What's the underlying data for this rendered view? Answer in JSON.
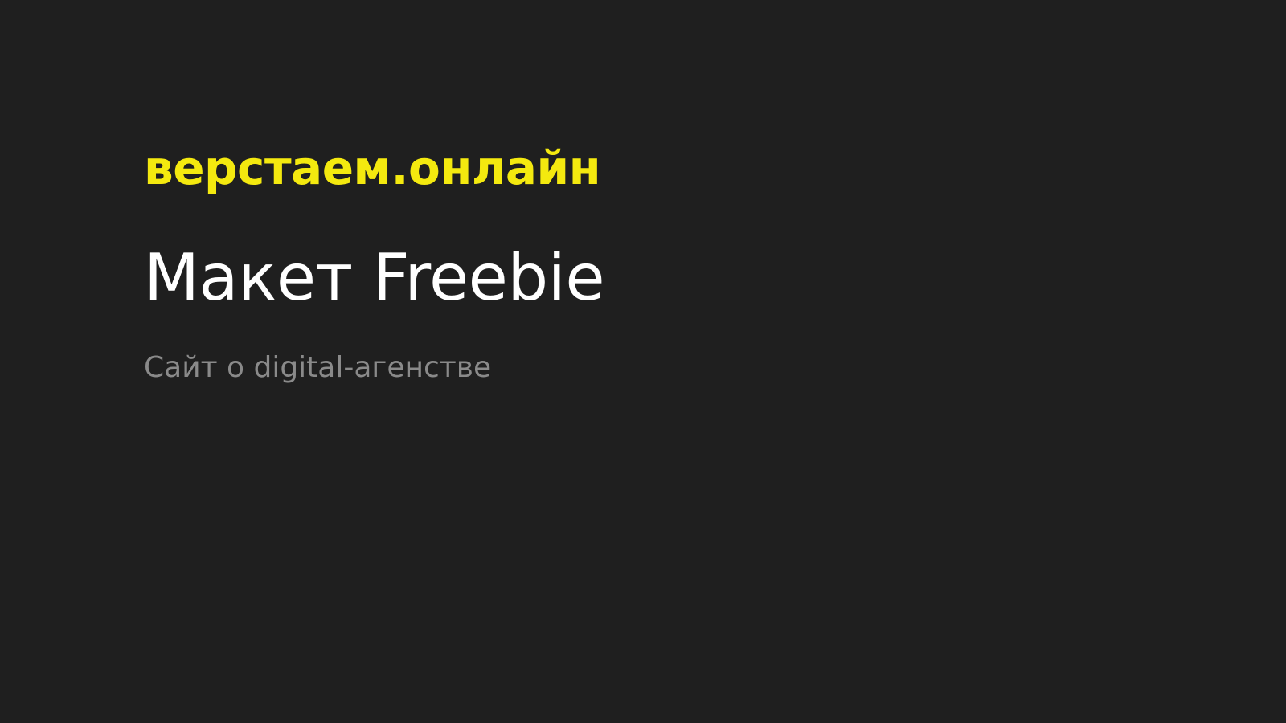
{
  "slide": {
    "brand": "верстаем.онлайн",
    "title": "Макет Freebie",
    "subtitle": "Сайт о digital-агенстве"
  },
  "colors": {
    "background": "#1f1f1f",
    "brand": "#f4e90f",
    "title": "#ffffff",
    "subtitle": "#8a8a8a"
  }
}
